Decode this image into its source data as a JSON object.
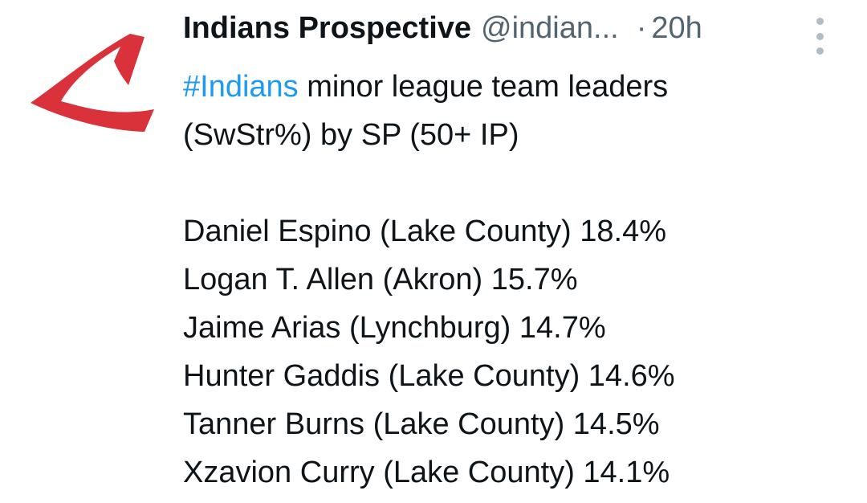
{
  "tweet": {
    "display_name": "Indians Prospective",
    "handle": "@indian...",
    "separator": "·",
    "time": "20h",
    "more_icon": "more-vertical-icon",
    "avatar_icon": "red-c-logo-icon",
    "hashtag": "#Indians",
    "line1_rest": " minor league team leaders",
    "line2": "(SwStr%) by SP (50+ IP)",
    "leaders": [
      "Daniel Espino (Lake County) 18.4%",
      "Logan T. Allen (Akron) 15.7%",
      "Jaime Arias (Lynchburg) 14.7%",
      "Hunter Gaddis (Lake County) 14.6%",
      "Tanner Burns (Lake County) 14.5%",
      "Xzavion Curry (Lake County) 14.1%"
    ],
    "colors": {
      "hashtag": "#1d9bf0",
      "secondary_text": "#536471",
      "logo_red": "#d9323a"
    }
  }
}
